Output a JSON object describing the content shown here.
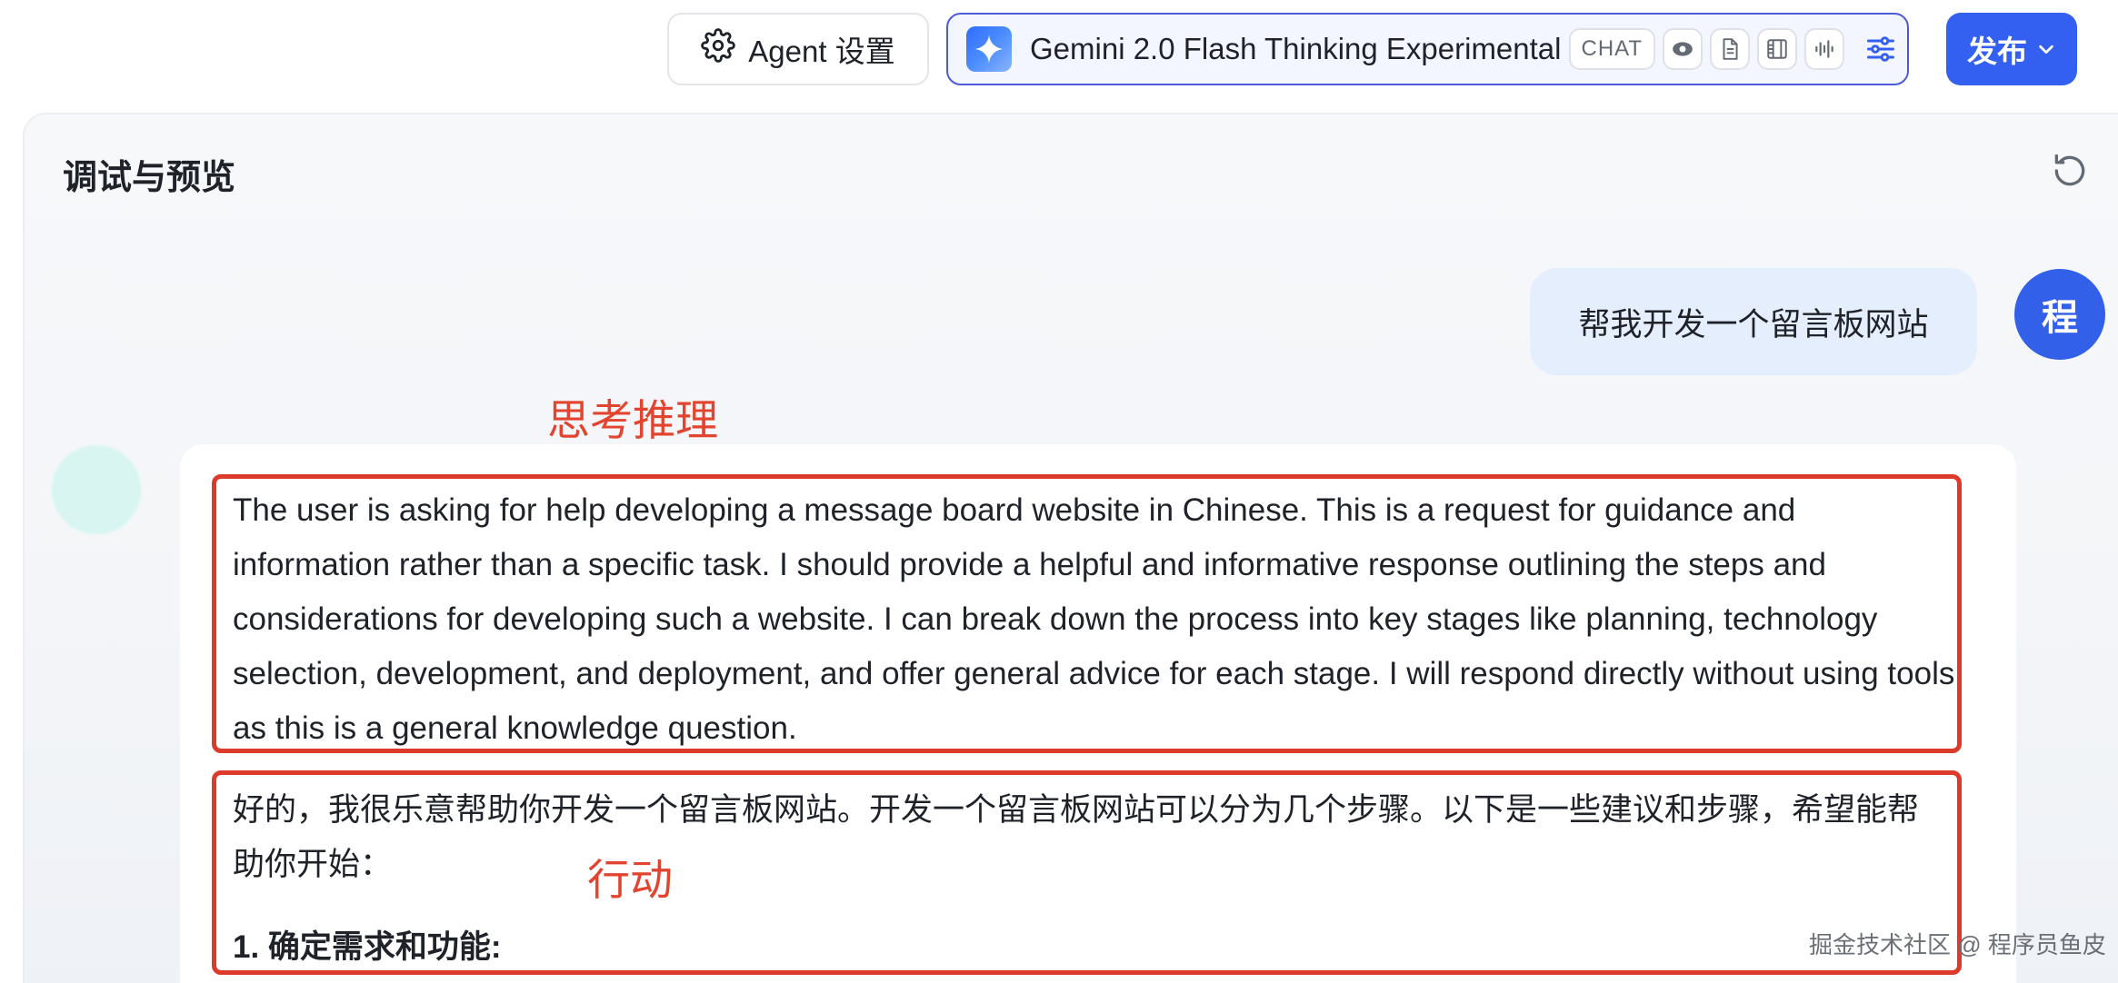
{
  "header": {
    "agent_settings_label": "Agent 设置",
    "model_name": "Gemini 2.0 Flash Thinking Experimental",
    "model_tag": "CHAT",
    "capability_icons": [
      "eye-icon",
      "document-icon",
      "video-icon",
      "audio-icon"
    ],
    "publish_label": "发布"
  },
  "panel": {
    "title": "调试与预览"
  },
  "chat": {
    "user_message": "帮我开发一个留言板网站",
    "user_avatar_text": "程",
    "thinking_annotation": "思考推理",
    "action_annotation": "行动",
    "thinking_text": "The user is asking for help developing a message board website in Chinese. This is a request for guidance and information rather than a specific task. I should provide a helpful and informative response outlining the steps and considerations for developing such a website. I can break down the process into key stages like planning, technology selection, development, and deployment, and offer general advice for each stage. I will respond directly without using tools as this is a general knowledge question.",
    "response_intro": "好的，我很乐意帮助你开发一个留言板网站。开发一个留言板网站可以分为几个步骤。以下是一些建议和步骤，希望能帮助你开始：",
    "response_heading": "1. 确定需求和功能:"
  },
  "watermark": "掘金技术社区 @ 程序员鱼皮",
  "colors": {
    "accent": "#3360f0",
    "annotation_red": "#dc3b2c",
    "user_bubble": "#e5eefc",
    "bot_avatar": "#d8f5f1"
  }
}
